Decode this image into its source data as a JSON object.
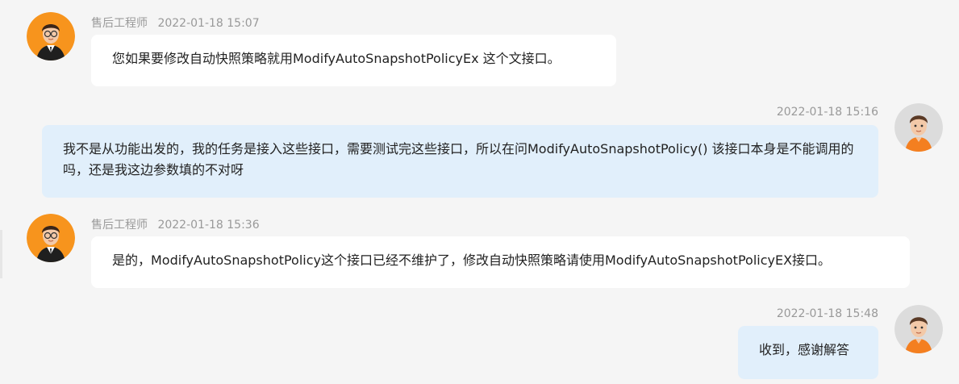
{
  "messages": [
    {
      "side": "left",
      "sender": "售后工程师",
      "time": "2022-01-18 15:07",
      "text": "您如果要修改自动快照策略就用ModifyAutoSnapshotPolicyEx 这个文接口。",
      "avatar": "engineer-avatar-icon"
    },
    {
      "side": "right",
      "sender": "",
      "time": "2022-01-18 15:16",
      "text": "我不是从功能出发的，我的任务是接入这些接口，需要测试完这些接口，所以在问ModifyAutoSnapshotPolicy() 该接口本身是不能调用的吗，还是我这边参数填的不对呀",
      "avatar": "user-avatar-icon"
    },
    {
      "side": "left",
      "sender": "售后工程师",
      "time": "2022-01-18 15:36",
      "text": "是的，ModifyAutoSnapshotPolicy这个接口已经不维护了，修改自动快照策略请使用ModifyAutoSnapshotPolicyEX接口。",
      "avatar": "engineer-avatar-icon"
    },
    {
      "side": "right",
      "sender": "",
      "time": "2022-01-18 15:48",
      "text": "收到，感谢解答",
      "avatar": "user-avatar-icon"
    }
  ],
  "colors": {
    "background": "#f5f5f5",
    "left_bubble": "#ffffff",
    "right_bubble": "#e1effb",
    "meta_text": "#999999",
    "message_text": "#222222",
    "engineer_avatar_bg": "#f7941d",
    "user_avatar_bg": "#dcdcdc"
  }
}
